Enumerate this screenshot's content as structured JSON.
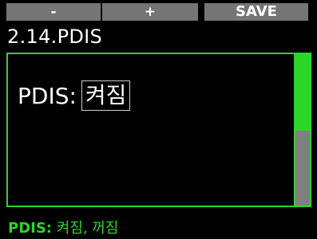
{
  "softkeys": {
    "minus_label": "-",
    "plus_label": "+",
    "save_label": "SAVE"
  },
  "header": {
    "title": "2.14.PDIS"
  },
  "setting": {
    "label": "PDIS:",
    "value": "켜짐"
  },
  "scrollbar": {
    "position_fraction": 0.5
  },
  "footer": {
    "hint_key": "PDIS:",
    "hint_options": " 켜짐, 꺼짐"
  },
  "colors": {
    "accent": "#2bd62b",
    "softkey_bg": "#757575",
    "background": "#000000",
    "scroll_inactive": "#808080"
  }
}
